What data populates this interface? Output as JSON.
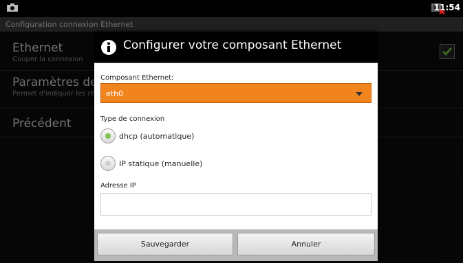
{
  "status_bar": {
    "time": "11:54"
  },
  "app": {
    "title": "Configuration connexion Ethernet"
  },
  "background_list": {
    "items": [
      {
        "title": "Ethernet",
        "subtitle": "Couper la connexion"
      },
      {
        "title": "Paramètres de",
        "subtitle": "Permet d'indiquer les ré"
      },
      {
        "title": "Précédent",
        "subtitle": ""
      }
    ]
  },
  "dialog": {
    "title": "Configurer votre composant Ethernet",
    "component_label": "Composant Ethernet:",
    "component_value": "eth0",
    "connection_type_label": "Type de connexion",
    "radio_dhcp": "dhcp (automatique)",
    "radio_static": "IP statique (manuelle)",
    "ip_label": "Adresse IP",
    "ip_value": "",
    "buttons": {
      "save": "Sauvegarder",
      "cancel": "Annuler"
    }
  },
  "colors": {
    "accent_orange": "#f2841e",
    "radio_selected": "#7dc24a",
    "check_green": "#6cbf3c"
  }
}
